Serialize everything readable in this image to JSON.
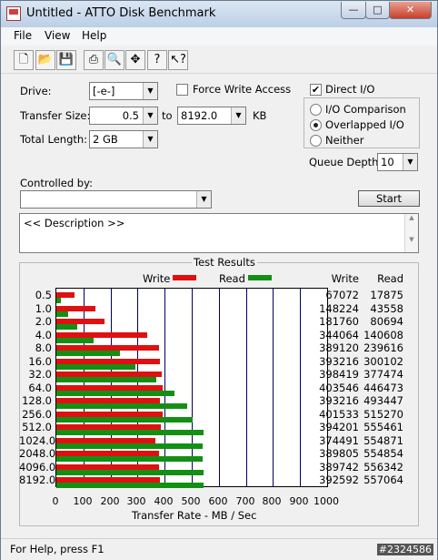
{
  "window": {
    "title": "Untitled - ATTO Disk Benchmark",
    "minimize": "—",
    "maximize": "□",
    "close": "✕"
  },
  "menu": {
    "file": "File",
    "view": "View",
    "help": "Help"
  },
  "toolbar": {
    "icons": [
      "new-icon",
      "open-icon",
      "save-icon",
      "print-icon",
      "print-preview-icon",
      "move-icon",
      "help-icon",
      "context-help-icon"
    ]
  },
  "settings": {
    "drive_label": "Drive:",
    "drive_value": "[-e-]",
    "force_write_label": "Force Write Access",
    "direct_io_label": "Direct I/O",
    "direct_io_checked": "✔",
    "transfer_size_label": "Transfer Size:",
    "transfer_from": "0.5",
    "to_label": "to",
    "transfer_to": "8192.0",
    "kb_label": "KB",
    "total_length_label": "Total Length:",
    "total_length_value": "2 GB",
    "io_comparison_label": "I/O Comparison",
    "overlapped_io_label": "Overlapped I/O",
    "neither_label": "Neither",
    "queue_depth_label": "Queue Depth:",
    "queue_depth_value": "10",
    "controlled_by_label": "Controlled by:",
    "controlled_by_value": "",
    "start_label": "Start",
    "description_text": "<< Description >>"
  },
  "results": {
    "title": "Test Results",
    "legend_write": "Write",
    "legend_read": "Read",
    "col_write": "Write",
    "col_read": "Read",
    "xlabel": "Transfer Rate - MB / Sec"
  },
  "chart_data": {
    "type": "bar",
    "orientation": "horizontal",
    "categories": [
      "0.5",
      "1.0",
      "2.0",
      "4.0",
      "8.0",
      "16.0",
      "32.0",
      "64.0",
      "128.0",
      "256.0",
      "512.0",
      "1024.0",
      "2048.0",
      "4096.0",
      "8192.0"
    ],
    "series": [
      {
        "name": "Write",
        "color": "#e01010",
        "values": [
          67072,
          148224,
          181760,
          344064,
          389120,
          393216,
          398419,
          403546,
          393216,
          401533,
          394201,
          374491,
          389805,
          389742,
          392592
        ]
      },
      {
        "name": "Read",
        "color": "#139013",
        "values": [
          17875,
          43558,
          80694,
          140608,
          239616,
          300102,
          377474,
          446473,
          493447,
          515270,
          555461,
          554871,
          554854,
          556342,
          557064
        ]
      }
    ],
    "value_unit_divisor": 1024,
    "xlabel": "Transfer Rate - MB / Sec",
    "xticks": [
      "0",
      "100",
      "200",
      "300",
      "400",
      "500",
      "600",
      "700",
      "800",
      "900",
      "1000"
    ],
    "xlim": [
      0,
      1000
    ],
    "grid": true,
    "legend": "top"
  },
  "status": {
    "text": "For Help, press F1",
    "watermark": "#2324586"
  }
}
